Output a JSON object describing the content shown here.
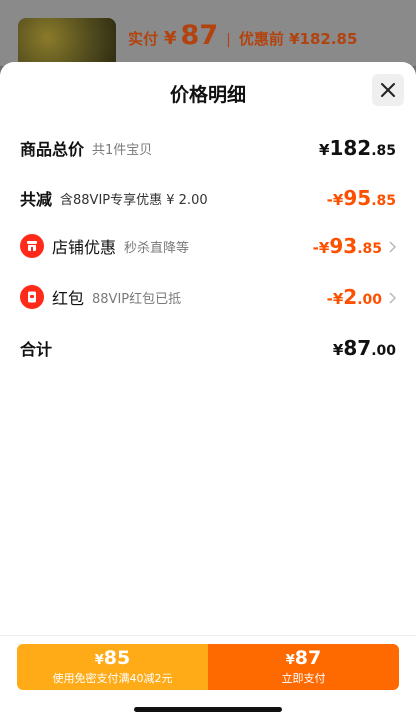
{
  "background_page": {
    "price_label": "实付",
    "currency": "¥",
    "price": "87",
    "separator": "|",
    "original_price": "优惠前 ¥182.85"
  },
  "sheet": {
    "title": "价格明细",
    "close_icon": "close-icon"
  },
  "rows": {
    "total": {
      "label": "商品总价",
      "sub": "共1件宝贝",
      "currency": "¥",
      "int": "182",
      "dec": ".85"
    },
    "discount": {
      "label": "共减",
      "sub": "含88VIP专享优惠 ¥ 2.00",
      "currency": "-¥",
      "int": "95",
      "dec": ".85"
    },
    "store": {
      "label": "店铺优惠",
      "sub": "秒杀直降等",
      "currency": "-¥",
      "int": "93",
      "dec": ".85",
      "icon": "store-icon"
    },
    "redpacket": {
      "label": "红包",
      "sub": "88VIP红包已抵",
      "currency": "-¥",
      "int": "2",
      "dec": ".00",
      "icon": "red-packet-icon"
    },
    "sum": {
      "label": "合计",
      "currency": "¥",
      "int": "87",
      "dec": ".00"
    }
  },
  "bottom_bar": {
    "left": {
      "currency": "¥",
      "amount": "85",
      "sub": "使用免密支付满40减2元"
    },
    "right": {
      "currency": "¥",
      "amount": "87",
      "sub": "立即支付"
    }
  },
  "colors": {
    "accent": "#ff5000",
    "pay_left": "#ffab18",
    "pay_right": "#ff6a00",
    "badge": "#ff2a1a"
  }
}
